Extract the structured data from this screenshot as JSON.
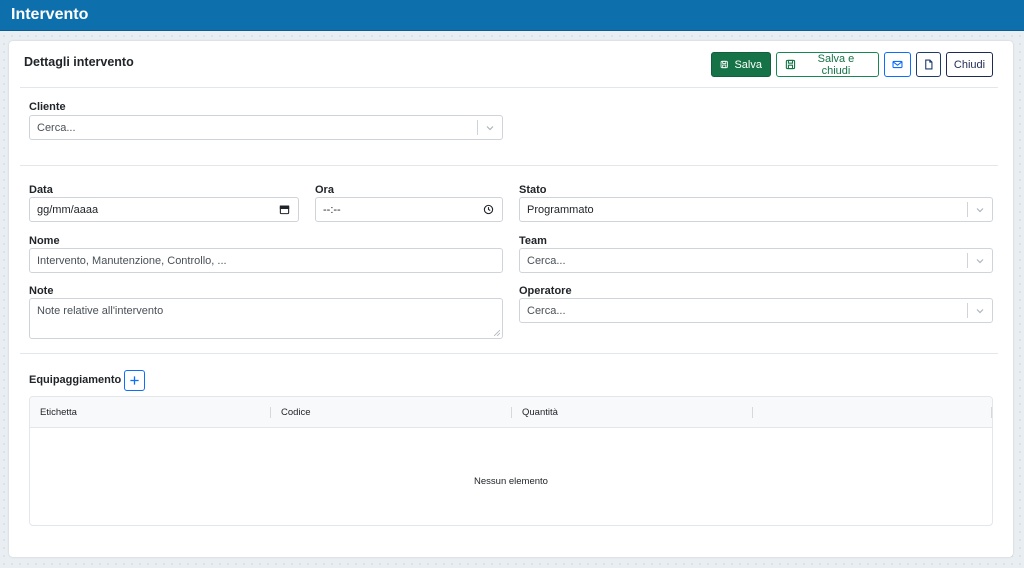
{
  "header": {
    "title": "Intervento"
  },
  "card": {
    "title": "Dettagli intervento"
  },
  "toolbar": {
    "save_label": "Salva",
    "save_close_label": "Salva e chiudi",
    "close_label": "Chiudi"
  },
  "form": {
    "cliente": {
      "label": "Cliente",
      "placeholder": "Cerca..."
    },
    "data": {
      "label": "Data",
      "value": "gg/mm/aaaa"
    },
    "ora": {
      "label": "Ora",
      "value": "--:--"
    },
    "stato": {
      "label": "Stato",
      "value": "Programmato"
    },
    "nome": {
      "label": "Nome",
      "placeholder": "Intervento, Manutenzione, Controllo, ..."
    },
    "team": {
      "label": "Team",
      "placeholder": "Cerca..."
    },
    "note": {
      "label": "Note",
      "placeholder": "Note relative all'intervento"
    },
    "operatore": {
      "label": "Operatore",
      "placeholder": "Cerca..."
    }
  },
  "equipment": {
    "title": "Equipaggiamento",
    "columns": [
      "Etichetta",
      "Codice",
      "Quantità"
    ],
    "empty_message": "Nessun elemento"
  },
  "colors": {
    "topbar": "#0e6fad",
    "primary_green": "#157347",
    "outline_blue": "#0d6efd",
    "dark_navy": "#1e2a55"
  }
}
